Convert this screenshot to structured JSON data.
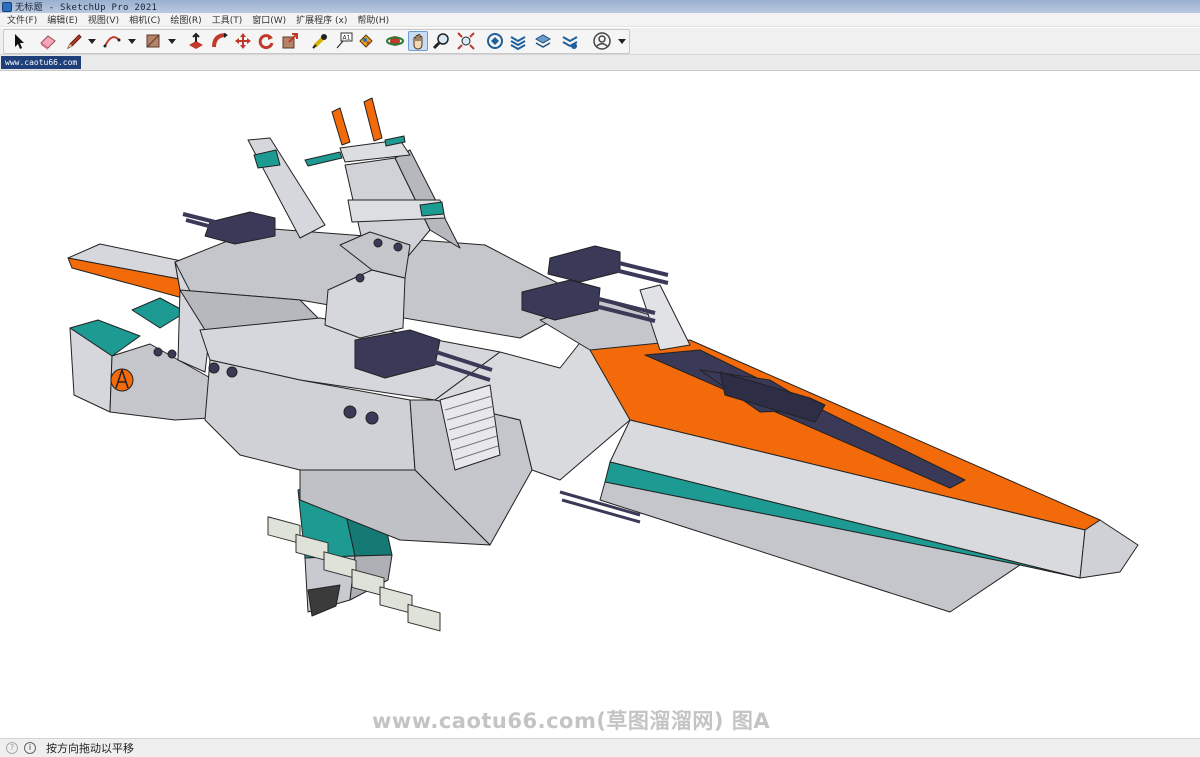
{
  "window": {
    "title": "无标题 - SketchUp Pro 2021"
  },
  "menu": [
    "文件(F)",
    "编辑(E)",
    "视图(V)",
    "相机(C)",
    "绘图(R)",
    "工具(T)",
    "窗口(W)",
    "扩展程序 (x)",
    "帮助(H)"
  ],
  "toolbar": {
    "tools": [
      "select",
      "eraser",
      "line",
      "arc",
      "rectangle",
      "push-pull",
      "follow-me",
      "move",
      "rotate",
      "scale",
      "tape-measure",
      "text",
      "paint-bucket",
      "orbit",
      "pan",
      "zoom",
      "zoom-extents",
      "warehouse",
      "extension-warehouse",
      "layout",
      "extension-manager",
      "account"
    ],
    "active_tool": "pan"
  },
  "scene_tab": {
    "label": "www.caotu66.com"
  },
  "watermark": {
    "text": "www.caotu66.com(草图溜溜网) 图A"
  },
  "status": {
    "hint": "按方向拖动以平移"
  },
  "colors": {
    "hull_light": "#d5d7dd",
    "hull_mid": "#c4c6cc",
    "hull_dark": "#aeb0b6",
    "accent_orange": "#f26a0a",
    "accent_teal": "#1d9b93",
    "turret": "#3a3a58",
    "active_tool_bg": "#c8ddf3",
    "scene_tab_bg": "#1e3f7a"
  }
}
